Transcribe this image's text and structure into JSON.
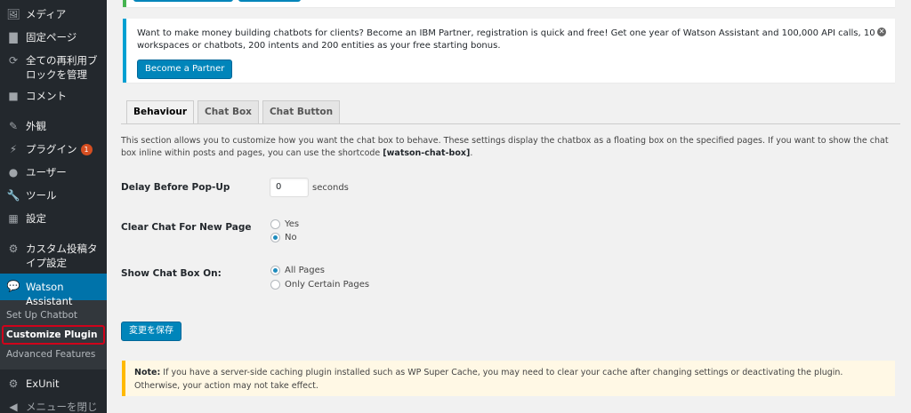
{
  "sidebar": {
    "items": [
      {
        "icon": "media-icon",
        "glyph": "🖼",
        "label": "メディア"
      },
      {
        "icon": "page-icon",
        "glyph": "▇",
        "label": "固定ページ"
      },
      {
        "icon": "blocks-icon",
        "glyph": "⟳",
        "label": "全ての再利用ブロックを管理"
      },
      {
        "icon": "comment-icon",
        "glyph": "■",
        "label": "コメント"
      },
      {
        "icon": "appearance-icon",
        "glyph": "✎",
        "label": "外観"
      },
      {
        "icon": "plugin-icon",
        "glyph": "⚡",
        "label": "プラグイン",
        "badge": "1"
      },
      {
        "icon": "user-icon",
        "glyph": "●",
        "label": "ユーザー"
      },
      {
        "icon": "tool-icon",
        "glyph": "🔧",
        "label": "ツール"
      },
      {
        "icon": "settings-icon",
        "glyph": "▦",
        "label": "設定"
      },
      {
        "icon": "gear-icon",
        "glyph": "⚙",
        "label": "カスタム投稿タイプ設定"
      }
    ],
    "current": {
      "icon": "chat-icon",
      "glyph": "💬",
      "label": "Watson Assistant"
    },
    "submenu": [
      "Set Up Chatbot",
      "Customize Plugin",
      "Advanced Features"
    ],
    "after": [
      {
        "icon": "exunit-icon",
        "glyph": "⚙",
        "label": "ExUnit"
      },
      {
        "icon": "collapse-icon",
        "glyph": "◀",
        "label": "メニューを閉じる"
      }
    ]
  },
  "partner_notice": {
    "text": "Want to make money building chatbots for clients? Become an IBM Partner, registration is quick and free! Get one year of Watson Assistant and 100,000 API calls, 10 workspaces or chatbots, 200 intents and 200 entities as your free starting bonus.",
    "button": "Become a Partner"
  },
  "tabs": [
    "Behaviour",
    "Chat Box",
    "Chat Button"
  ],
  "description": {
    "text": "This section allows you to customize how you want the chat box to behave. These settings display the chatbox as a floating box on the specified pages. If you want to show the chat box inline within posts and pages, you can use the shortcode ",
    "shortcode": "[watson-chat-box]",
    "end": "."
  },
  "form": {
    "delay_label": "Delay Before Pop-Up",
    "delay_value": "0",
    "delay_suffix": "seconds",
    "clear_label": "Clear Chat For New Page",
    "clear_options": [
      "Yes",
      "No"
    ],
    "clear_selected": "No",
    "show_label": "Show Chat Box On:",
    "show_options": [
      "All Pages",
      "Only Certain Pages"
    ],
    "show_selected": "All Pages",
    "save_button": "変更を保存"
  },
  "note": {
    "prefix": "Note:",
    "text": " If you have a server-side caching plugin installed such as WP Super Cache, you may need to clear your cache after changing settings or deactivating the plugin. Otherwise, your action may not take effect."
  },
  "colors": {
    "sidebar_bg": "#23282d",
    "accent": "#0073aa",
    "button": "#0085ba",
    "notice_info": "#00a0d2",
    "notice_warning": "#ffb900",
    "badge": "#d54e21"
  }
}
